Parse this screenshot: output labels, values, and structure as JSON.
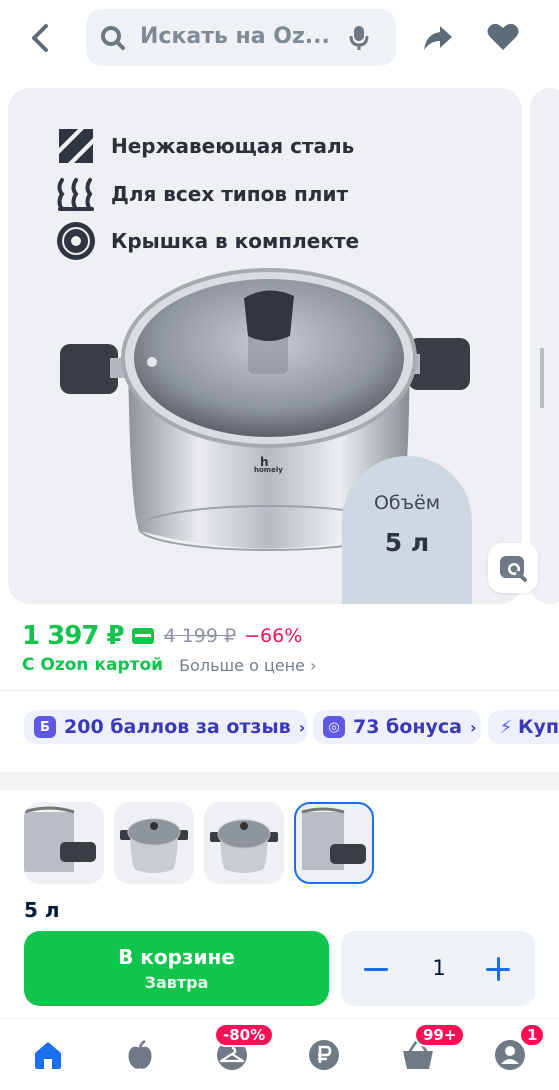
{
  "search": {
    "placeholder": "Искать на Oz..."
  },
  "gallery": {
    "features": [
      {
        "icon": "steel-icon",
        "text": "Нержавеющая сталь"
      },
      {
        "icon": "heating-coil-icon",
        "text": "Для всех типов плит"
      },
      {
        "icon": "lid-icon",
        "text": "Крышка в комплекте"
      }
    ],
    "brand": "homely",
    "volume_label": "Объём",
    "volume_value": "5 л"
  },
  "price": {
    "current": "1 397 ₽",
    "old": "4 199 ₽",
    "discount": "−66%",
    "ozon_card": "С Ozon картой",
    "more": "Больше о цене ›"
  },
  "chips": [
    {
      "icon": "Б",
      "text": "200 баллов за отзыв",
      "chevron": "›"
    },
    {
      "icon": "◎",
      "text": "73 бонуса",
      "chevron": "›"
    },
    {
      "icon": "⚡",
      "text": "Куп"
    }
  ],
  "variants": {
    "selected_index": 3,
    "size": "5 л"
  },
  "cart": {
    "label": "В корзине",
    "sub": "Завтра",
    "quantity": "1"
  },
  "nav": {
    "badges": {
      "fresh": "-80%",
      "cart": "99+",
      "profile": "1"
    }
  },
  "colors": {
    "accent_green": "#10c44c",
    "accent_blue": "#1a6ef0",
    "discount_red": "#f91155",
    "bonus_purple": "#5d59e5"
  }
}
